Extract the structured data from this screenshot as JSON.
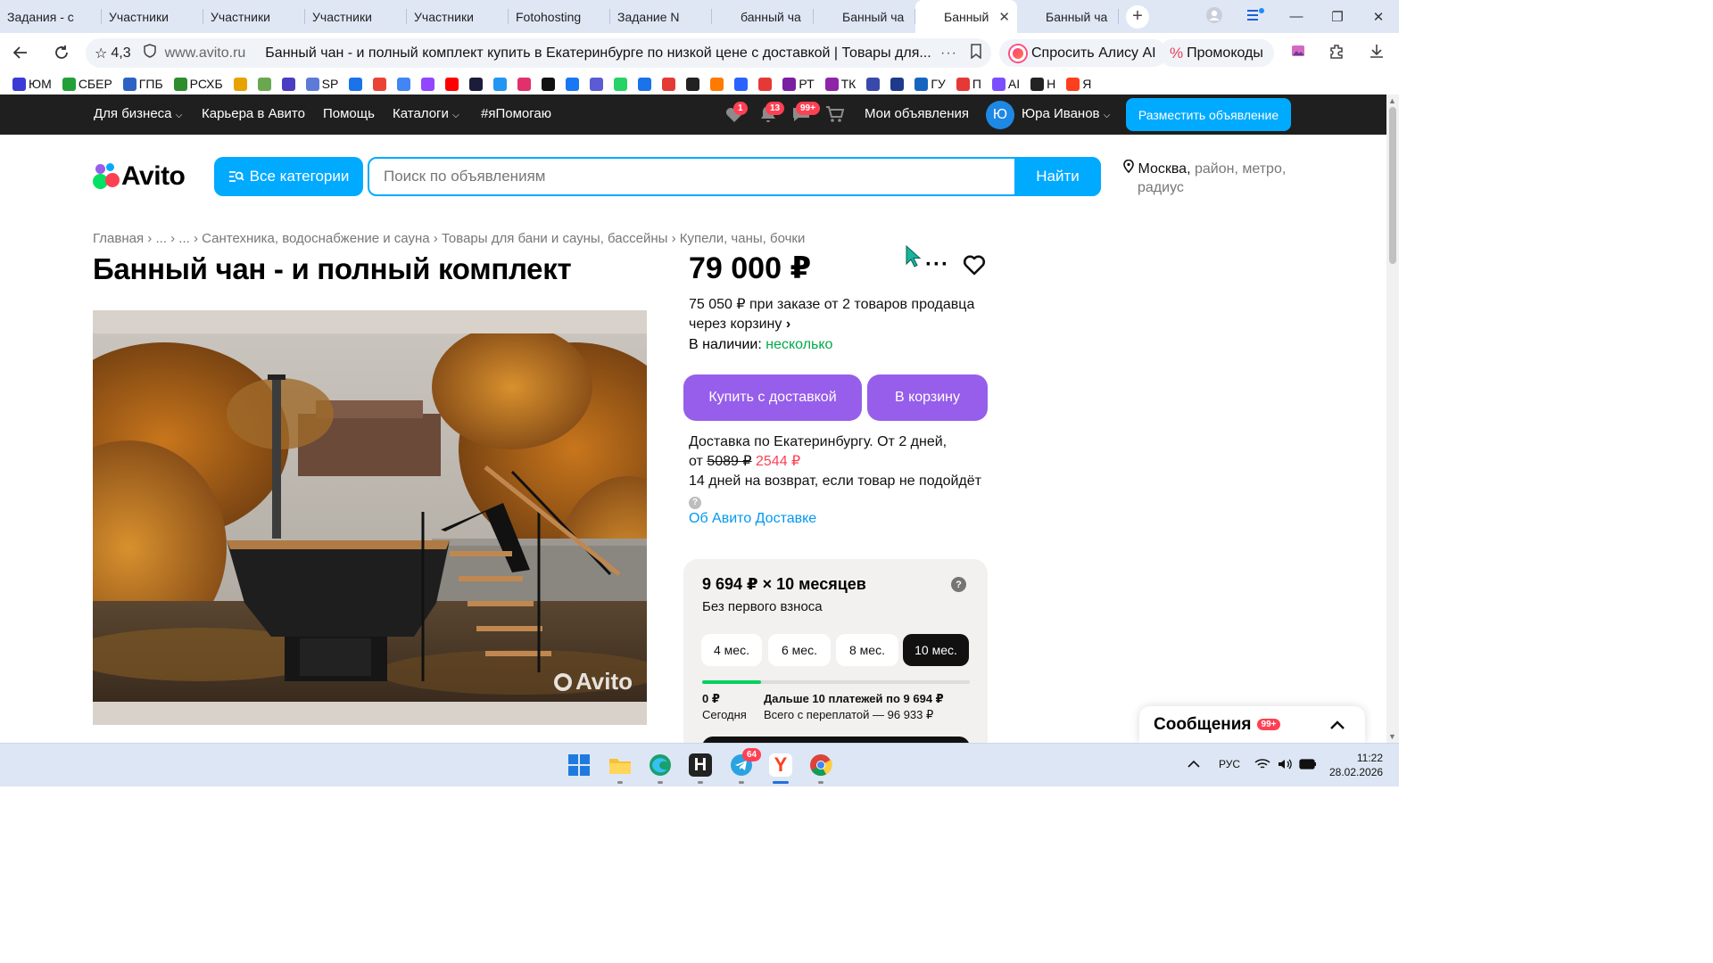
{
  "browser": {
    "tabs": [
      {
        "icon": "sp",
        "title": "Задания - c"
      },
      {
        "icon": "sp",
        "title": "Участники"
      },
      {
        "icon": "sp",
        "title": "Участники"
      },
      {
        "icon": "sp",
        "title": "Участники"
      },
      {
        "icon": "sp",
        "title": "Участники"
      },
      {
        "icon": "fotohosting",
        "title": "Fotohosting"
      },
      {
        "icon": "sp",
        "title": "Задание N"
      },
      {
        "icon": "avito",
        "title": "банный ча"
      },
      {
        "icon": "avito",
        "title": "Банный ча"
      },
      {
        "icon": "avito",
        "title": "Банный",
        "active": true
      },
      {
        "icon": "avito",
        "title": "Банный ча"
      }
    ],
    "address": {
      "rating": "4,3",
      "domain": "www.avito.ru",
      "page_title": "Банный чан - и полный комплект купить в Екатеринбурге по низкой цене с доставкой | Товары для..."
    },
    "alice_label": "Спросить Алису AI",
    "promo_label": "Промокоды",
    "bookmarks": [
      {
        "label": "ЮМ",
        "color": "#3a3ad4"
      },
      {
        "label": "СБЕР",
        "color": "#21a038"
      },
      {
        "label": "ГПБ",
        "color": "#2b62c4"
      },
      {
        "label": "РСХБ",
        "color": "#2e8b2e"
      },
      {
        "label": "",
        "color": "#e8a200"
      },
      {
        "label": "",
        "color": "#6aa84f"
      },
      {
        "label": "",
        "color": "#4b3cc4"
      },
      {
        "label": "SP",
        "color": "#5d7bd6"
      },
      {
        "label": "",
        "color": "#1a73e8"
      },
      {
        "label": "",
        "color": "#ea4335"
      },
      {
        "label": "",
        "color": "#4285f4"
      },
      {
        "label": "",
        "color": "#9146ff"
      },
      {
        "label": "",
        "color": "#ff0000"
      },
      {
        "label": "",
        "color": "#1b1b3a"
      },
      {
        "label": "",
        "color": "#2196f3"
      },
      {
        "label": "",
        "color": "#e1306c"
      },
      {
        "label": "",
        "color": "#111111"
      },
      {
        "label": "",
        "color": "#1877f2"
      },
      {
        "label": "",
        "color": "#5b5bd6"
      },
      {
        "label": "",
        "color": "#25d366"
      },
      {
        "label": "",
        "color": "#1a73e8"
      },
      {
        "label": "",
        "color": "#e53935"
      },
      {
        "label": "",
        "color": "#222222"
      },
      {
        "label": "",
        "color": "#ff7a00"
      },
      {
        "label": "",
        "color": "#2962ff"
      },
      {
        "label": "",
        "color": "#e53935"
      },
      {
        "label": "РТ",
        "color": "#7b1fa2"
      },
      {
        "label": "ТК",
        "color": "#8e24aa"
      },
      {
        "label": "",
        "color": "#3949ab"
      },
      {
        "label": "",
        "color": "#1e3a8a"
      },
      {
        "label": "ГУ",
        "color": "#1565c0"
      },
      {
        "label": "П",
        "color": "#e53935"
      },
      {
        "label": "AI",
        "color": "#7c4dff"
      },
      {
        "label": "Н",
        "color": "#222222"
      },
      {
        "label": "Я",
        "color": "#fc3f1d"
      }
    ]
  },
  "avito_nav": {
    "links": [
      "Для бизнеса",
      "Карьера в Авито",
      "Помощь",
      "Каталоги",
      "#яПомогаю"
    ],
    "badges": {
      "favorites": "1",
      "notifications": "13",
      "messages": "99+"
    },
    "my_ads": "Мои объявления",
    "avatar_letter": "Ю",
    "user_name": "Юра Иванов",
    "post_button": "Разместить объявление"
  },
  "header": {
    "logo": "Avito",
    "categories_button": "Все категории",
    "search_placeholder": "Поиск по объявлениям",
    "search_button": "Найти",
    "location_city": "Москва,",
    "location_rest": "район, метро,",
    "location_rest2": "радиус"
  },
  "breadcrumbs": [
    "Главная",
    "...",
    "...",
    "Сантехника, водоснабжение и сауна",
    "Товары для бани и сауны, бассейны",
    "Купели, чаны, бочки"
  ],
  "listing": {
    "title": "Банный чан - и полный комплект",
    "price": "79 000 ₽",
    "bulk_price": "75 050 ₽ при заказе от 2 товаров продавца через корзину",
    "stock_label": "В наличии:",
    "stock_value": "несколько",
    "buy_button": "Купить с доставкой",
    "cart_button": "В корзину",
    "delivery_line1": "Доставка по Екатеринбургу. От 2 дней,",
    "delivery_from": "от",
    "delivery_old_price": "5089 ₽",
    "delivery_new_price": "2544 ₽",
    "return_text": "14 дней на возврат, если товар не подойдёт",
    "about_link": "Об Авито Доставке",
    "watermark": "Avito"
  },
  "installment": {
    "heading": "9 694 ₽ × 10 месяцев",
    "subheading": "Без первого взноса",
    "terms": [
      "4 мес.",
      "6 мес.",
      "8 мес.",
      "10 мес."
    ],
    "selected_term": "10 мес.",
    "paid_fraction": 0.22,
    "today_amount": "0 ₽",
    "today_label": "Сегодня",
    "next_label": "Дальше 10 платежей по 9 694 ₽",
    "total_label": "Всего с переплатой — 96 933 ₽"
  },
  "messages_widget": {
    "label": "Сообщения",
    "badge": "99+"
  },
  "taskbar": {
    "telegram_badge": "64",
    "language": "РУС",
    "time": "11:22",
    "date": "28.02.2026"
  }
}
